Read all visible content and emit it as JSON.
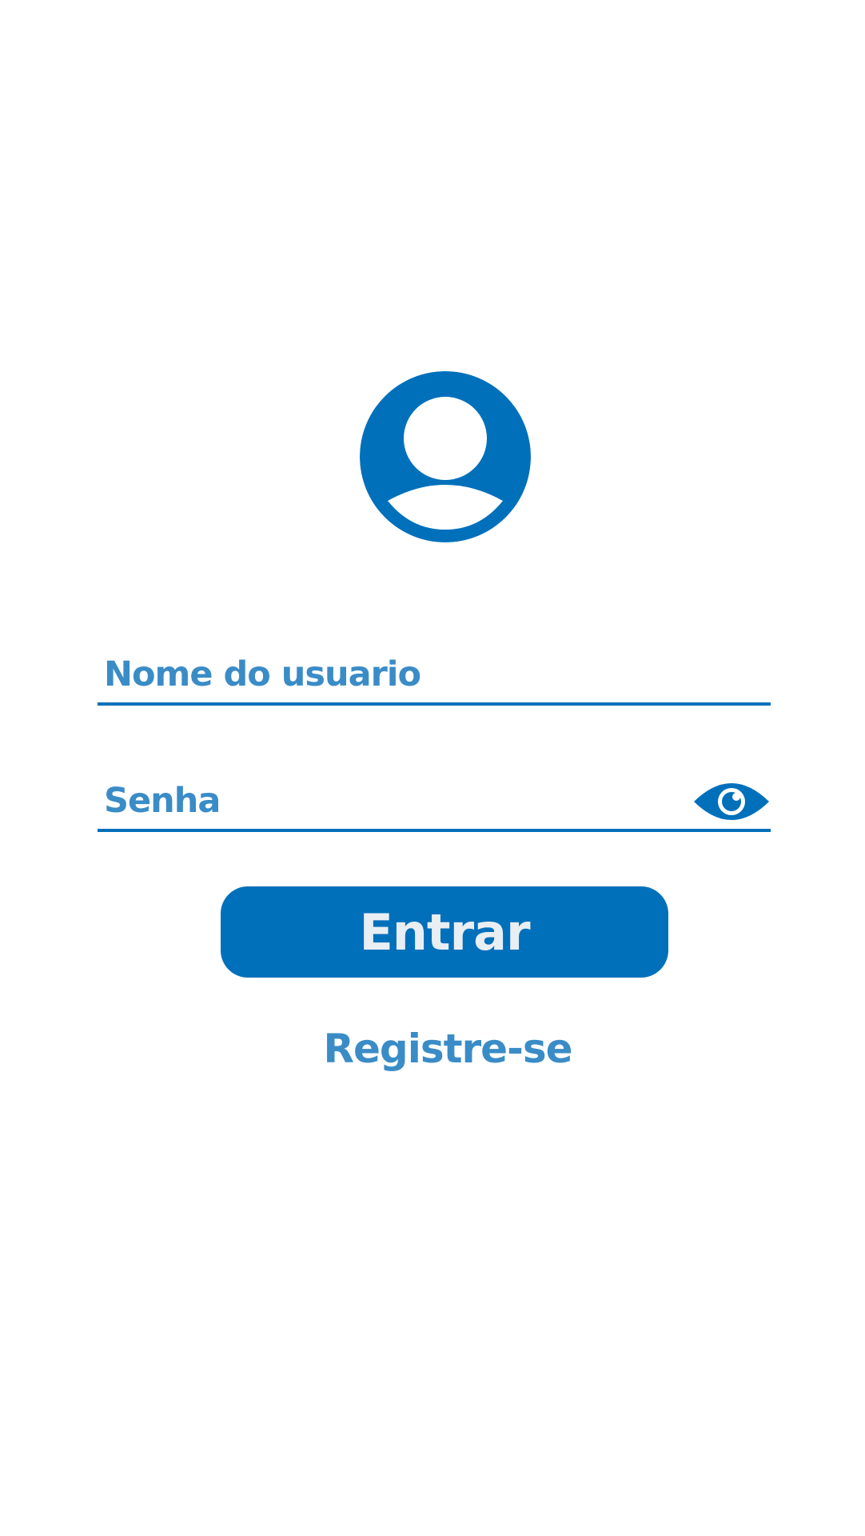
{
  "colors": {
    "primary": "#0070bb",
    "label": "#3a8cc7",
    "button_text": "#e9eef3",
    "background": "#ffffff"
  },
  "icons": {
    "avatar": "user-avatar-icon",
    "show_password": "eye-icon"
  },
  "form": {
    "username_placeholder": "Nome do usuario",
    "username_value": "",
    "password_placeholder": "Senha",
    "password_value": ""
  },
  "actions": {
    "login_label": "Entrar",
    "register_label": "Registre-se"
  }
}
